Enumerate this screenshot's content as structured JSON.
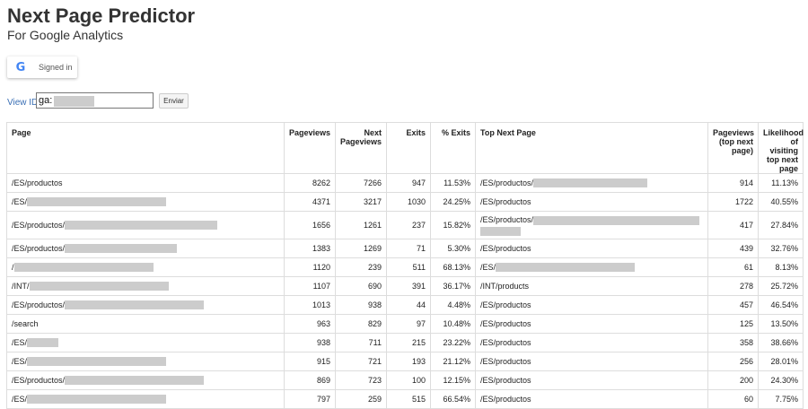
{
  "header": {
    "title": "Next Page Predictor",
    "subtitle": "For Google Analytics"
  },
  "signin": {
    "icon": "google-g-icon",
    "logo_letter": "G",
    "label": "Signed in"
  },
  "view_id": {
    "label": "View ID",
    "value": "ga:",
    "submit_label": "Enviar"
  },
  "table": {
    "headers": [
      "Page",
      "Pageviews",
      "Next Pageviews",
      "Exits",
      "% Exits",
      "Top Next Page",
      "Pageviews (top next page)",
      "Likelihood of visiting top next page"
    ],
    "rows": [
      {
        "page": "/ES/productos",
        "pr": 0,
        "pageviews": "8262",
        "next": "7266",
        "exits": "947",
        "pct": "11.53%",
        "top": "/ES/productos/",
        "tr": 127,
        "tpv": "914",
        "lik": "11.13%"
      },
      {
        "page": "/ES/",
        "pr": 155,
        "pageviews": "4371",
        "next": "3217",
        "exits": "1030",
        "pct": "24.25%",
        "top": "/ES/productos",
        "tr": 0,
        "tpv": "1722",
        "lik": "40.55%"
      },
      {
        "page": "/ES/productos/",
        "pr": 170,
        "pageviews": "1656",
        "next": "1261",
        "exits": "237",
        "pct": "15.82%",
        "top": "/ES/productos/",
        "tr": 185,
        "tr2": 45,
        "tpv": "417",
        "lik": "27.84%"
      },
      {
        "page": "/ES/productos/",
        "pr": 125,
        "pageviews": "1383",
        "next": "1269",
        "exits": "71",
        "pct": "5.30%",
        "top": "/ES/productos",
        "tr": 0,
        "tpv": "439",
        "lik": "32.76%"
      },
      {
        "page": "/",
        "pr": 155,
        "pageviews": "1120",
        "next": "239",
        "exits": "511",
        "pct": "68.13%",
        "top": "/ES/",
        "tr": 155,
        "tpv": "61",
        "lik": "8.13%"
      },
      {
        "page": "/INT/",
        "pr": 155,
        "pageviews": "1107",
        "next": "690",
        "exits": "391",
        "pct": "36.17%",
        "top": "/INT/products",
        "tr": 0,
        "tpv": "278",
        "lik": "25.72%"
      },
      {
        "page": "/ES/productos/",
        "pr": 155,
        "pageviews": "1013",
        "next": "938",
        "exits": "44",
        "pct": "4.48%",
        "top": "/ES/productos",
        "tr": 0,
        "tpv": "457",
        "lik": "46.54%"
      },
      {
        "page": "/search",
        "pr": 0,
        "pageviews": "963",
        "next": "829",
        "exits": "97",
        "pct": "10.48%",
        "top": "/ES/productos",
        "tr": 0,
        "tpv": "125",
        "lik": "13.50%"
      },
      {
        "page": "/ES/",
        "pr": 35,
        "pageviews": "938",
        "next": "711",
        "exits": "215",
        "pct": "23.22%",
        "top": "/ES/productos",
        "tr": 0,
        "tpv": "358",
        "lik": "38.66%"
      },
      {
        "page": "/ES/",
        "pr": 155,
        "pageviews": "915",
        "next": "721",
        "exits": "193",
        "pct": "21.12%",
        "top": "/ES/productos",
        "tr": 0,
        "tpv": "256",
        "lik": "28.01%"
      },
      {
        "page": "/ES/productos/",
        "pr": 155,
        "pageviews": "869",
        "next": "723",
        "exits": "100",
        "pct": "12.15%",
        "top": "/ES/productos",
        "tr": 0,
        "tpv": "200",
        "lik": "24.30%"
      },
      {
        "page": "/ES/",
        "pr": 155,
        "pageviews": "797",
        "next": "259",
        "exits": "515",
        "pct": "66.54%",
        "top": "/ES/productos",
        "tr": 0,
        "tpv": "60",
        "lik": "7.75%"
      }
    ]
  }
}
